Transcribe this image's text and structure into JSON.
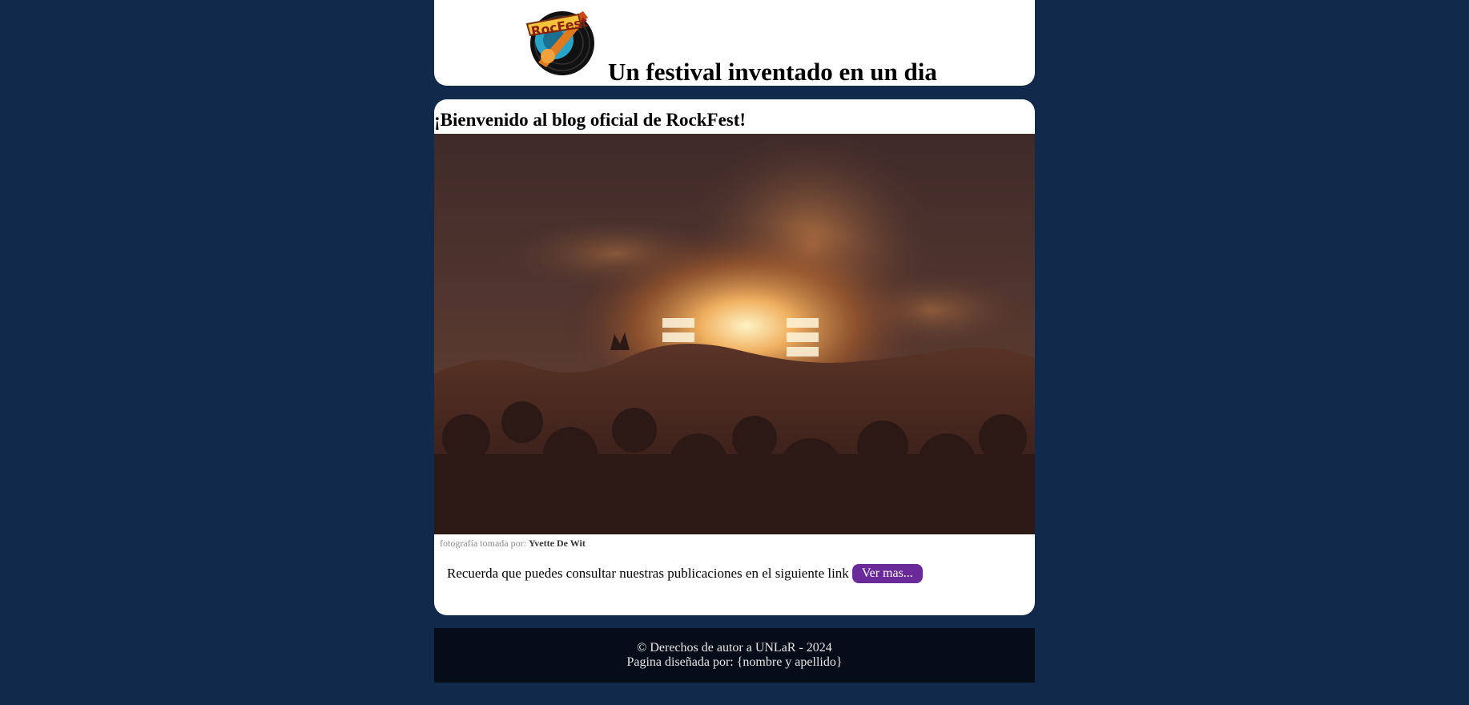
{
  "header": {
    "logo_text": "RocFest",
    "title": "Un festival inventado en un dia"
  },
  "main": {
    "welcome": "¡Bienvenido al blog oficial de RockFest!",
    "photo_credit_prefix": "fotografía tomada por:",
    "photo_credit_author": "Yvette De Wit",
    "note": "Recuerda que puedes consultar nuestras publicaciones en el siguiente link",
    "button_label": "Ver mas..."
  },
  "footer": {
    "copyright": "© Derechos de autor a UNLaR - 2024",
    "designed_by": "Pagina diseñada por: {nombre y apellido}"
  },
  "colors": {
    "background": "#112a4b",
    "button": "#6a2a9a",
    "footer": "#060d18"
  }
}
